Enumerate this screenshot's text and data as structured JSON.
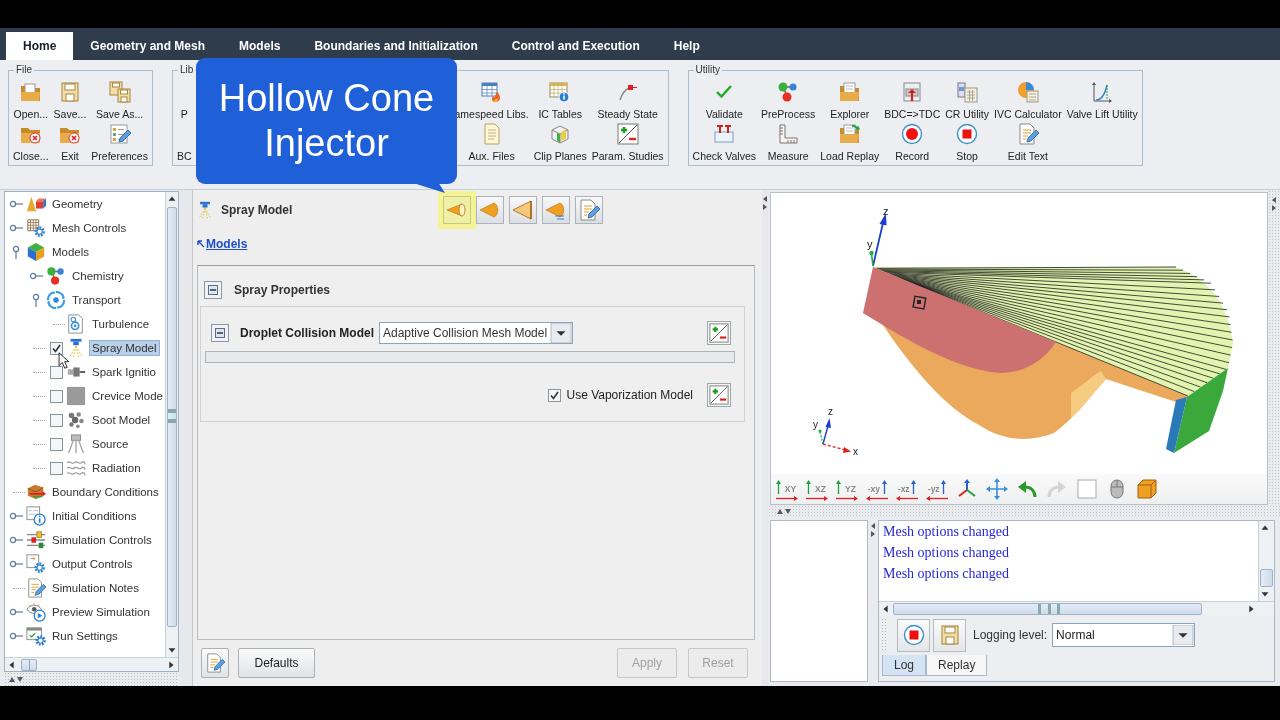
{
  "tabs": [
    {
      "label": "Home",
      "selected": true
    },
    {
      "label": "Geometry and Mesh",
      "selected": false
    },
    {
      "label": "Models",
      "selected": false
    },
    {
      "label": "Boundaries and Initialization",
      "selected": false
    },
    {
      "label": "Control and Execution",
      "selected": false
    },
    {
      "label": "Help",
      "selected": false
    }
  ],
  "ribbon": [
    {
      "title": "File",
      "columns": [
        [
          "Open...",
          "Close..."
        ],
        [
          "Save...",
          "Exit"
        ],
        [
          "Save As...",
          "Preferences"
        ]
      ]
    },
    {
      "title": "Lib",
      "columns": [
        [
          "P",
          "BC"
        ],
        [
          "amespeed Libs.",
          "Aux. Files"
        ],
        [
          "IC Tables",
          "Clip Planes"
        ],
        [
          "Steady State",
          "Param. Studies"
        ]
      ]
    },
    {
      "title": "Utility",
      "columns": [
        [
          "Validate",
          "Check Valves"
        ],
        [
          "PreProcess",
          "Measure"
        ],
        [
          "Explorer",
          "Load Replay"
        ],
        [
          "BDC=>TDC",
          "Record"
        ],
        [
          "CR Utility",
          "Stop"
        ],
        [
          "IVC Calculator",
          "Edit Text"
        ],
        [
          "Valve Lift Utility"
        ]
      ]
    }
  ],
  "callout": {
    "text": "Hollow Cone Injector"
  },
  "tree": [
    {
      "label": "Geometry",
      "kind": "branch",
      "expanded": false,
      "selected": false
    },
    {
      "label": "Mesh Controls",
      "kind": "branch",
      "expanded": false,
      "selected": false
    },
    {
      "label": "Models",
      "kind": "branch",
      "expanded": true,
      "selected": false,
      "children": [
        {
          "label": "Chemistry",
          "kind": "branch",
          "expanded": false,
          "selected": false
        },
        {
          "label": "Transport",
          "kind": "branch",
          "expanded": true,
          "selected": false,
          "children": [
            {
              "label": "Turbulence",
              "kind": "leaf",
              "selected": false
            }
          ]
        },
        {
          "label": "Spray Model",
          "kind": "toggle",
          "checked": true,
          "selected": true
        },
        {
          "label": "Spark Ignitio",
          "kind": "toggle",
          "checked": false,
          "selected": false
        },
        {
          "label": "Crevice Mode",
          "kind": "toggle",
          "checked": false,
          "selected": false
        },
        {
          "label": "Soot Model",
          "kind": "toggle",
          "checked": false,
          "selected": false
        },
        {
          "label": "Source",
          "kind": "toggle",
          "checked": false,
          "selected": false
        },
        {
          "label": "Radiation",
          "kind": "toggle",
          "checked": false,
          "selected": false
        }
      ]
    },
    {
      "label": "Boundary Conditions",
      "kind": "leaf",
      "selected": false
    },
    {
      "label": "Initial Conditions",
      "kind": "branch",
      "expanded": false,
      "selected": false
    },
    {
      "label": "Simulation Controls",
      "kind": "branch",
      "expanded": false,
      "selected": false
    },
    {
      "label": "Output Controls",
      "kind": "branch",
      "expanded": false,
      "selected": false
    },
    {
      "label": "Simulation Notes",
      "kind": "leaf",
      "selected": false
    },
    {
      "label": "Preview Simulation",
      "kind": "branch",
      "expanded": false,
      "selected": false
    },
    {
      "label": "Run Settings",
      "kind": "branch",
      "expanded": false,
      "selected": false
    }
  ],
  "panel": {
    "title": "Spray Model",
    "injector_buttons": [
      {
        "selected": true
      },
      {
        "selected": false
      },
      {
        "selected": false
      },
      {
        "selected": false
      },
      {
        "selected": false
      }
    ],
    "back_link": "Models",
    "section": {
      "title": "Spray Properties",
      "expanded": true
    },
    "collision": {
      "label": "Droplet Collision Model",
      "expanded": true,
      "value": "Adaptive Collision Mesh Model"
    },
    "vaporization": {
      "label": "Use Vaporization Model",
      "checked": true
    },
    "footer_left": [
      {
        "label": "Defaults",
        "disabled": false
      }
    ],
    "footer_right": [
      {
        "label": "Apply",
        "disabled": true
      },
      {
        "label": "Reset",
        "disabled": true
      }
    ]
  },
  "viewport": {
    "triad_labels": [
      "z",
      "y"
    ],
    "corner_triad_labels": [
      "z",
      "y",
      "x"
    ],
    "toolbar": [
      {
        "kind": "plane",
        "label": "XY",
        "disabled": false
      },
      {
        "kind": "plane",
        "label": "XZ",
        "disabled": false
      },
      {
        "kind": "plane",
        "label": "YZ",
        "disabled": false
      },
      {
        "kind": "neg-plane",
        "label": "-xy",
        "disabled": false
      },
      {
        "kind": "neg-plane",
        "label": "-xz",
        "disabled": false
      },
      {
        "kind": "neg-plane",
        "label": "-yz",
        "disabled": false
      },
      {
        "kind": "triad",
        "disabled": false
      },
      {
        "kind": "pan",
        "disabled": false
      },
      {
        "kind": "undo",
        "disabled": false
      },
      {
        "kind": "redo",
        "disabled": true
      },
      {
        "kind": "blank",
        "disabled": false
      },
      {
        "kind": "mouse",
        "disabled": false
      },
      {
        "kind": "box",
        "disabled": false
      }
    ]
  },
  "log": {
    "lines": [
      "Mesh options changed",
      "Mesh options changed",
      "Mesh options changed"
    ],
    "logging_label": "Logging level:",
    "logging_value": "Normal",
    "tabs": [
      {
        "label": "Log",
        "selected": true
      },
      {
        "label": "Replay",
        "selected": false
      }
    ]
  }
}
